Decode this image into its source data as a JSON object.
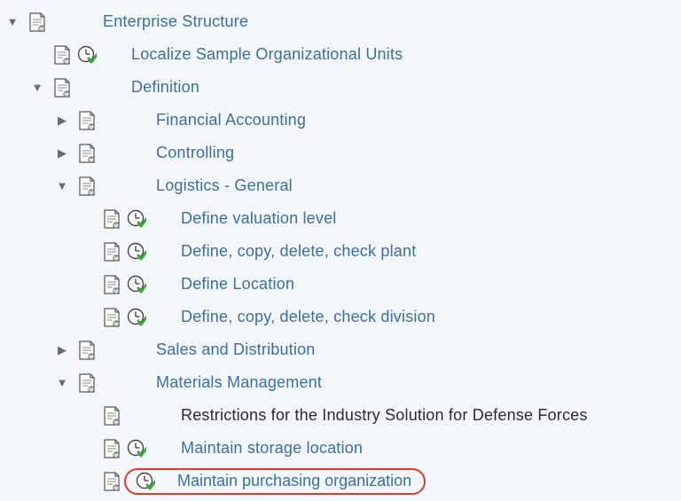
{
  "tree": {
    "root": "Enterprise Structure",
    "a1": "Localize Sample Organizational Units",
    "a2": "Definition",
    "b1": "Financial Accounting",
    "b2": "Controlling",
    "b3": "Logistics - General",
    "c1": "Define valuation level",
    "c2": "Define, copy, delete, check plant",
    "c3": "Define Location",
    "c4": "Define, copy, delete, check division",
    "b4": "Sales and Distribution",
    "b5": "Materials Management",
    "d1": "Restrictions for the Industry Solution for Defense Forces",
    "d2": "Maintain storage location",
    "d3": "Maintain purchasing organization"
  }
}
